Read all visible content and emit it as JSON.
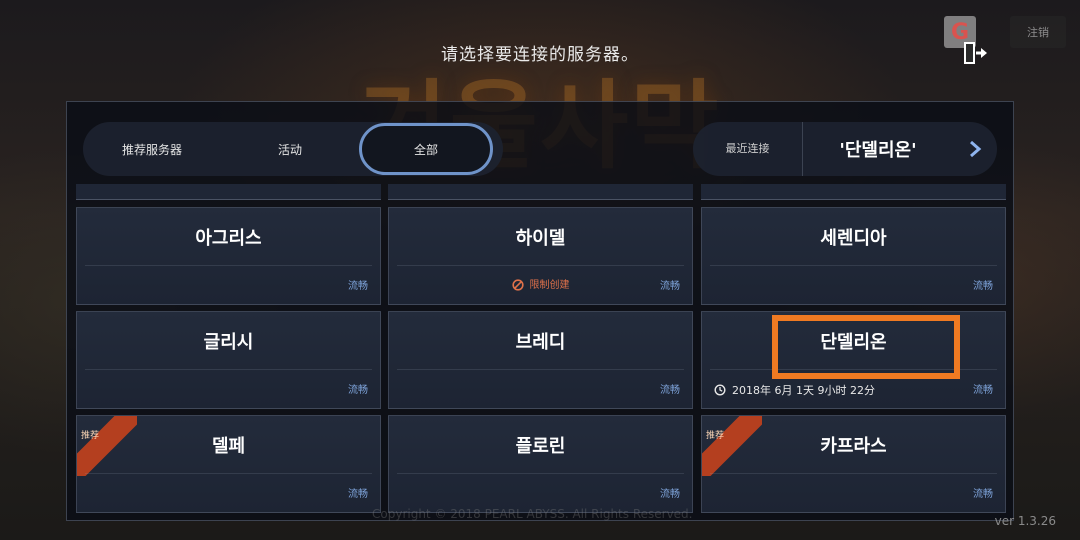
{
  "background": {
    "logo_text": "겨울사막"
  },
  "header": {
    "title": "请选择要连接的服务器。",
    "google_icon": "google-icon",
    "exit_icon": "exit-door-icon",
    "logout_label": "注销"
  },
  "tabs": {
    "recommended": "推荐服务器",
    "event": "活动",
    "all": "全部",
    "active": "全部"
  },
  "recent": {
    "label": "最近连接",
    "server_name": "'단델리온'",
    "arrow_icon": "chevron-right-icon"
  },
  "servers": [
    {
      "name": "아그리스",
      "status": "流畅"
    },
    {
      "name": "하이델",
      "status": "流畅",
      "restriction": "限制创建"
    },
    {
      "name": "세렌디아",
      "status": "流畅"
    },
    {
      "name": "글리시",
      "status": "流畅"
    },
    {
      "name": "브레디",
      "status": "流畅"
    },
    {
      "name": "단델리온",
      "status": "流畅",
      "open_time": "2018年 6月 1天 9小时 22分",
      "highlighted": true
    },
    {
      "name": "델페",
      "status": "流畅",
      "badge": "推荐"
    },
    {
      "name": "플로린",
      "status": "流畅"
    },
    {
      "name": "카프라스",
      "status": "流畅",
      "badge": "推荐"
    }
  ],
  "footer": {
    "copyright": "Copyright © 2018 PEARL ABYSS. All Rights Reserved.",
    "version": "ver 1.3.26"
  },
  "colors": {
    "highlight": "#ef7a22",
    "status_text": "#7fa5dc",
    "restrict_text": "#e0714a",
    "ribbon": "#b43f1f",
    "active_tab_border": "#6f93c9"
  }
}
